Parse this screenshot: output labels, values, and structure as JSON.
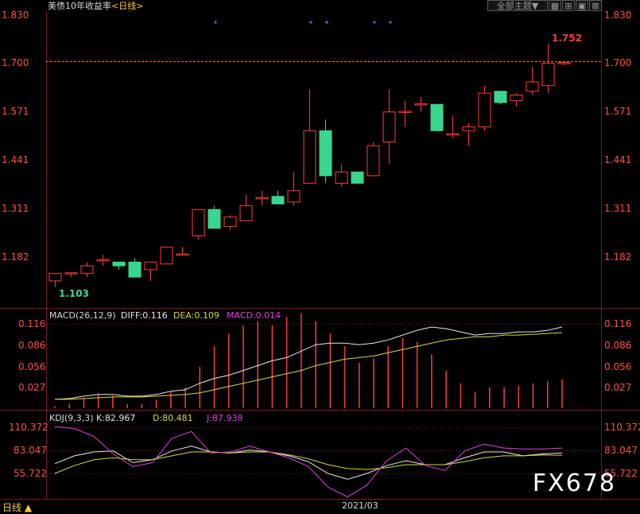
{
  "header": {
    "title": "美债10年收益率",
    "period": "<日线>",
    "theme_button": "全部主题▼",
    "icons": [
      "grid-icon",
      "maximize-icon",
      "window-icon",
      "close-icon"
    ]
  },
  "colors": {
    "up": "#ff3b3b",
    "down": "#3ad68f",
    "axis": "#ff4d4d",
    "diff": "#e8e8e8",
    "dea": "#d8d83a",
    "macd": "#e040e0",
    "k_line": "#e8e8e8",
    "d_line": "#d8d83a",
    "j_line": "#e040e0",
    "marker": "#2a7bd8"
  },
  "main_chart": {
    "y_ticks": [
      "1.830",
      "1.700",
      "1.571",
      "1.441",
      "1.311",
      "1.182"
    ],
    "high_label": "1.752",
    "low_label": "1.103",
    "ref_line_value": 1.7
  },
  "macd_panel": {
    "name": "MACD(26,12,9)",
    "diff_label": "DIFF:0.116",
    "dea_label": "DEA:0.109",
    "macd_label": "MACD:0.014",
    "y_ticks": [
      "0.116",
      "0.086",
      "0.056",
      "0.027"
    ]
  },
  "kdj_panel": {
    "name": "KDJ(9,3,3)",
    "k_label": "K:82.967",
    "d_label": "D:80.481",
    "j_label": "J:87.938",
    "y_ticks": [
      "110.372",
      "83.047",
      "55.722"
    ]
  },
  "footer": {
    "period_button": "日线 ▲",
    "date_label": "2021/03"
  },
  "watermark": "FX678",
  "chart_data": [
    {
      "type": "candlestick",
      "title": "美债10年收益率",
      "ylim": [
        1.103,
        1.83
      ],
      "ohlc": [
        [
          1.12,
          1.14,
          1.103,
          1.14
        ],
        [
          1.14,
          1.14,
          1.13,
          1.14
        ],
        [
          1.14,
          1.17,
          1.13,
          1.16
        ],
        [
          1.175,
          1.19,
          1.16,
          1.175
        ],
        [
          1.17,
          1.17,
          1.15,
          1.16
        ],
        [
          1.17,
          1.18,
          1.13,
          1.13
        ],
        [
          1.15,
          1.17,
          1.12,
          1.17
        ],
        [
          1.165,
          1.19,
          1.165,
          1.21
        ],
        [
          1.19,
          1.21,
          1.19,
          1.19
        ],
        [
          1.24,
          1.24,
          1.23,
          1.31
        ],
        [
          1.31,
          1.32,
          1.26,
          1.26
        ],
        [
          1.265,
          1.295,
          1.255,
          1.29
        ],
        [
          1.28,
          1.35,
          1.28,
          1.32
        ],
        [
          1.34,
          1.36,
          1.32,
          1.34
        ],
        [
          1.345,
          1.36,
          1.325,
          1.325
        ],
        [
          1.33,
          1.41,
          1.32,
          1.36
        ],
        [
          1.38,
          1.63,
          1.38,
          1.52
        ],
        [
          1.52,
          1.55,
          1.38,
          1.4
        ],
        [
          1.38,
          1.43,
          1.37,
          1.41
        ],
        [
          1.41,
          1.41,
          1.38,
          1.38
        ],
        [
          1.4,
          1.49,
          1.4,
          1.48
        ],
        [
          1.49,
          1.63,
          1.43,
          1.57
        ],
        [
          1.57,
          1.6,
          1.53,
          1.57
        ],
        [
          1.59,
          1.61,
          1.57,
          1.59
        ],
        [
          1.59,
          1.59,
          1.52,
          1.52
        ],
        [
          1.51,
          1.56,
          1.5,
          1.51
        ],
        [
          1.52,
          1.54,
          1.48,
          1.53
        ],
        [
          1.53,
          1.64,
          1.52,
          1.62
        ],
        [
          1.625,
          1.625,
          1.59,
          1.595
        ],
        [
          1.6,
          1.62,
          1.585,
          1.615
        ],
        [
          1.625,
          1.69,
          1.615,
          1.65
        ],
        [
          1.64,
          1.752,
          1.62,
          1.7
        ],
        [
          1.7,
          1.705,
          1.695,
          1.7
        ]
      ]
    },
    {
      "type": "line",
      "title": "MACD(26,12,9)",
      "ylim": [
        0.015,
        0.12
      ],
      "series": [
        {
          "name": "DIFF",
          "values": [
            0.026,
            0.027,
            0.03,
            0.032,
            0.032,
            0.03,
            0.03,
            0.032,
            0.036,
            0.038,
            0.046,
            0.052,
            0.056,
            0.062,
            0.068,
            0.074,
            0.078,
            0.086,
            0.094,
            0.096,
            0.096,
            0.094,
            0.096,
            0.1,
            0.106,
            0.112,
            0.116,
            0.114,
            0.11,
            0.106,
            0.108,
            0.108,
            0.11,
            0.11,
            0.112,
            0.116
          ]
        },
        {
          "name": "DEA",
          "values": [
            0.026,
            0.026,
            0.027,
            0.028,
            0.029,
            0.029,
            0.029,
            0.03,
            0.031,
            0.032,
            0.034,
            0.038,
            0.042,
            0.046,
            0.05,
            0.054,
            0.058,
            0.062,
            0.068,
            0.072,
            0.076,
            0.078,
            0.08,
            0.084,
            0.088,
            0.092,
            0.096,
            0.1,
            0.102,
            0.104,
            0.104,
            0.106,
            0.106,
            0.107,
            0.108,
            0.109
          ]
        },
        {
          "name": "MACD",
          "values": [
            0.001,
            0.002,
            0.005,
            0.007,
            0.006,
            0.002,
            0.002,
            0.004,
            0.008,
            0.01,
            0.02,
            0.03,
            0.036,
            0.04,
            0.042,
            0.04,
            0.044,
            0.046,
            0.042,
            0.036,
            0.03,
            0.022,
            0.024,
            0.03,
            0.034,
            0.032,
            0.026,
            0.018,
            0.012,
            0.008,
            0.01,
            0.01,
            0.011,
            0.012,
            0.013,
            0.014
          ]
        }
      ]
    },
    {
      "type": "line",
      "title": "KDJ(9,3,3)",
      "ylim": [
        40,
        115
      ],
      "series": [
        {
          "name": "K",
          "values": [
            72,
            80,
            84,
            85,
            73,
            76,
            85,
            90,
            84,
            83,
            86,
            84,
            80,
            74,
            62,
            56,
            62,
            70,
            75,
            71,
            71,
            78,
            84,
            84,
            80,
            82,
            83
          ]
        },
        {
          "name": "D",
          "values": [
            62,
            70,
            76,
            78,
            76,
            76,
            80,
            84,
            84,
            83,
            84,
            84,
            81,
            77,
            71,
            67,
            66,
            68,
            71,
            71,
            71,
            74,
            78,
            80,
            80,
            81,
            80.5
          ]
        },
        {
          "name": "J",
          "values": [
            110,
            108,
            100,
            82,
            69,
            73,
            98,
            105,
            83,
            84,
            90,
            84,
            78,
            69,
            48,
            38,
            50,
            75,
            88,
            70,
            65,
            85,
            92,
            88,
            87,
            87,
            88
          ]
        }
      ]
    }
  ]
}
